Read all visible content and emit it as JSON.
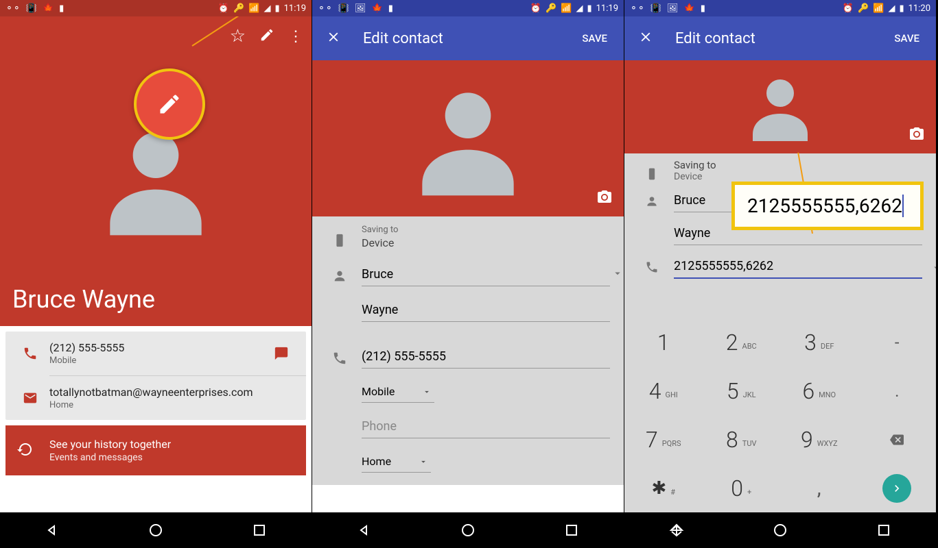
{
  "status": {
    "time1": "11:19",
    "time2": "11:19",
    "time3": "11:20"
  },
  "screen1": {
    "name": "Bruce Wayne",
    "phone": {
      "number": "(212) 555-5555",
      "type": "Mobile"
    },
    "email": {
      "address": "totallynotbatman@wayneenterprises.com",
      "type": "Home"
    },
    "history": {
      "title": "See your history together",
      "subtitle": "Events and messages"
    }
  },
  "screen2": {
    "title": "Edit contact",
    "save": "SAVE",
    "saving_to_label": "Saving to",
    "saving_to_value": "Device",
    "first_name": "Bruce",
    "last_name": "Wayne",
    "phone": "(212) 555-5555",
    "phone_type": "Mobile",
    "phone2_placeholder": "Phone",
    "phone2_type": "Home"
  },
  "screen3": {
    "title": "Edit contact",
    "save": "SAVE",
    "saving_to_label": "Saving to",
    "saving_to_value": "Device",
    "first_name": "Bruce",
    "last_name": "Wayne",
    "phone_raw": "2125555555,6262",
    "callout": "2125555555,6262"
  },
  "keypad": {
    "keys": [
      {
        "num": "1",
        "letters": ""
      },
      {
        "num": "2",
        "letters": "ABC"
      },
      {
        "num": "3",
        "letters": "DEF"
      },
      {
        "num": "-",
        "letters": ""
      },
      {
        "num": "4",
        "letters": "GHI"
      },
      {
        "num": "5",
        "letters": "JKL"
      },
      {
        "num": "6",
        "letters": "MNO"
      },
      {
        "num": ".",
        "letters": ""
      },
      {
        "num": "7",
        "letters": "PQRS"
      },
      {
        "num": "8",
        "letters": "TUV"
      },
      {
        "num": "9",
        "letters": "WXYZ"
      },
      {
        "num": "⌫",
        "letters": ""
      },
      {
        "num": "*",
        "letters": "#"
      },
      {
        "num": "0",
        "letters": "+"
      },
      {
        "num": ",",
        "letters": ""
      },
      {
        "num": "go",
        "letters": ""
      }
    ]
  }
}
